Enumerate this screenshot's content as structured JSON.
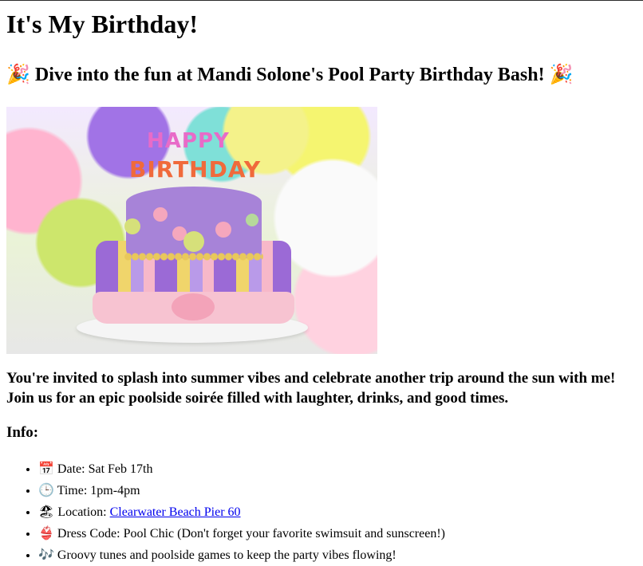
{
  "page": {
    "title": "It's My Birthday!",
    "subtitle": {
      "emoji_left": "🎉",
      "text": "Dive into the fun at Mandi Solone's Pool Party Birthday Bash!",
      "emoji_right": "🎉"
    },
    "hero_image": {
      "topper_line1": "HAPPY",
      "topper_line2": "BIRTHDAY",
      "icon": "birthday-cake-photo"
    },
    "lead": "You're invited to splash into summer vibes and celebrate another trip around the sun with me! Join us for an epic poolside soirée filled with laughter, drinks, and good times.",
    "info_heading": "Info:",
    "details": [
      {
        "icon": "calendar-icon",
        "glyph": "📅",
        "label": "Date:",
        "value": "Sat Feb 17th"
      },
      {
        "icon": "clock-icon",
        "glyph": "🕒",
        "label": "Time:",
        "value": "1pm-4pm"
      },
      {
        "icon": "location-icon",
        "glyph": "🏖",
        "label": "Location:",
        "link": "Clearwater Beach Pier 60"
      },
      {
        "icon": "swimsuit-icon",
        "glyph": "👙",
        "label": "Dress Code:",
        "value": "Pool Chic (Don't forget your favorite swimsuit and sunscreen!)"
      },
      {
        "icon": "music-notes-icon",
        "glyph": "🎶",
        "text": "Groovy tunes and poolside games to keep the party vibes flowing!"
      }
    ],
    "colors": {
      "link": "#0000ee",
      "text": "#000000",
      "background": "#ffffff"
    }
  }
}
